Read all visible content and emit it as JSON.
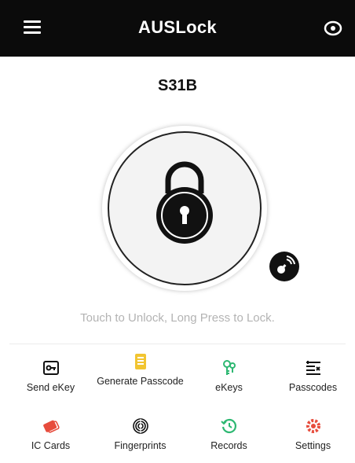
{
  "header": {
    "title": "AUSLock",
    "menu_icon": "hamburger-menu-icon",
    "right_icon": "eye-icon"
  },
  "lock": {
    "name": "S31B",
    "hint": "Touch to Unlock, Long Press to Lock."
  },
  "colors": {
    "topbar": "#0b0b0b",
    "green": "#2eb872",
    "red": "#e74c3c",
    "yellow": "#f2c531",
    "dark": "#111111"
  },
  "actions": [
    {
      "label": "Send eKey",
      "icon": "send-ekey-icon"
    },
    {
      "label": "Generate Passcode",
      "icon": "generate-passcode-icon"
    },
    {
      "label": "eKeys",
      "icon": "ekeys-icon"
    },
    {
      "label": "Passcodes",
      "icon": "passcodes-icon"
    },
    {
      "label": "IC Cards",
      "icon": "ic-cards-icon"
    },
    {
      "label": "Fingerprints",
      "icon": "fingerprint-icon"
    },
    {
      "label": "Records",
      "icon": "records-icon"
    },
    {
      "label": "Settings",
      "icon": "settings-icon"
    }
  ]
}
